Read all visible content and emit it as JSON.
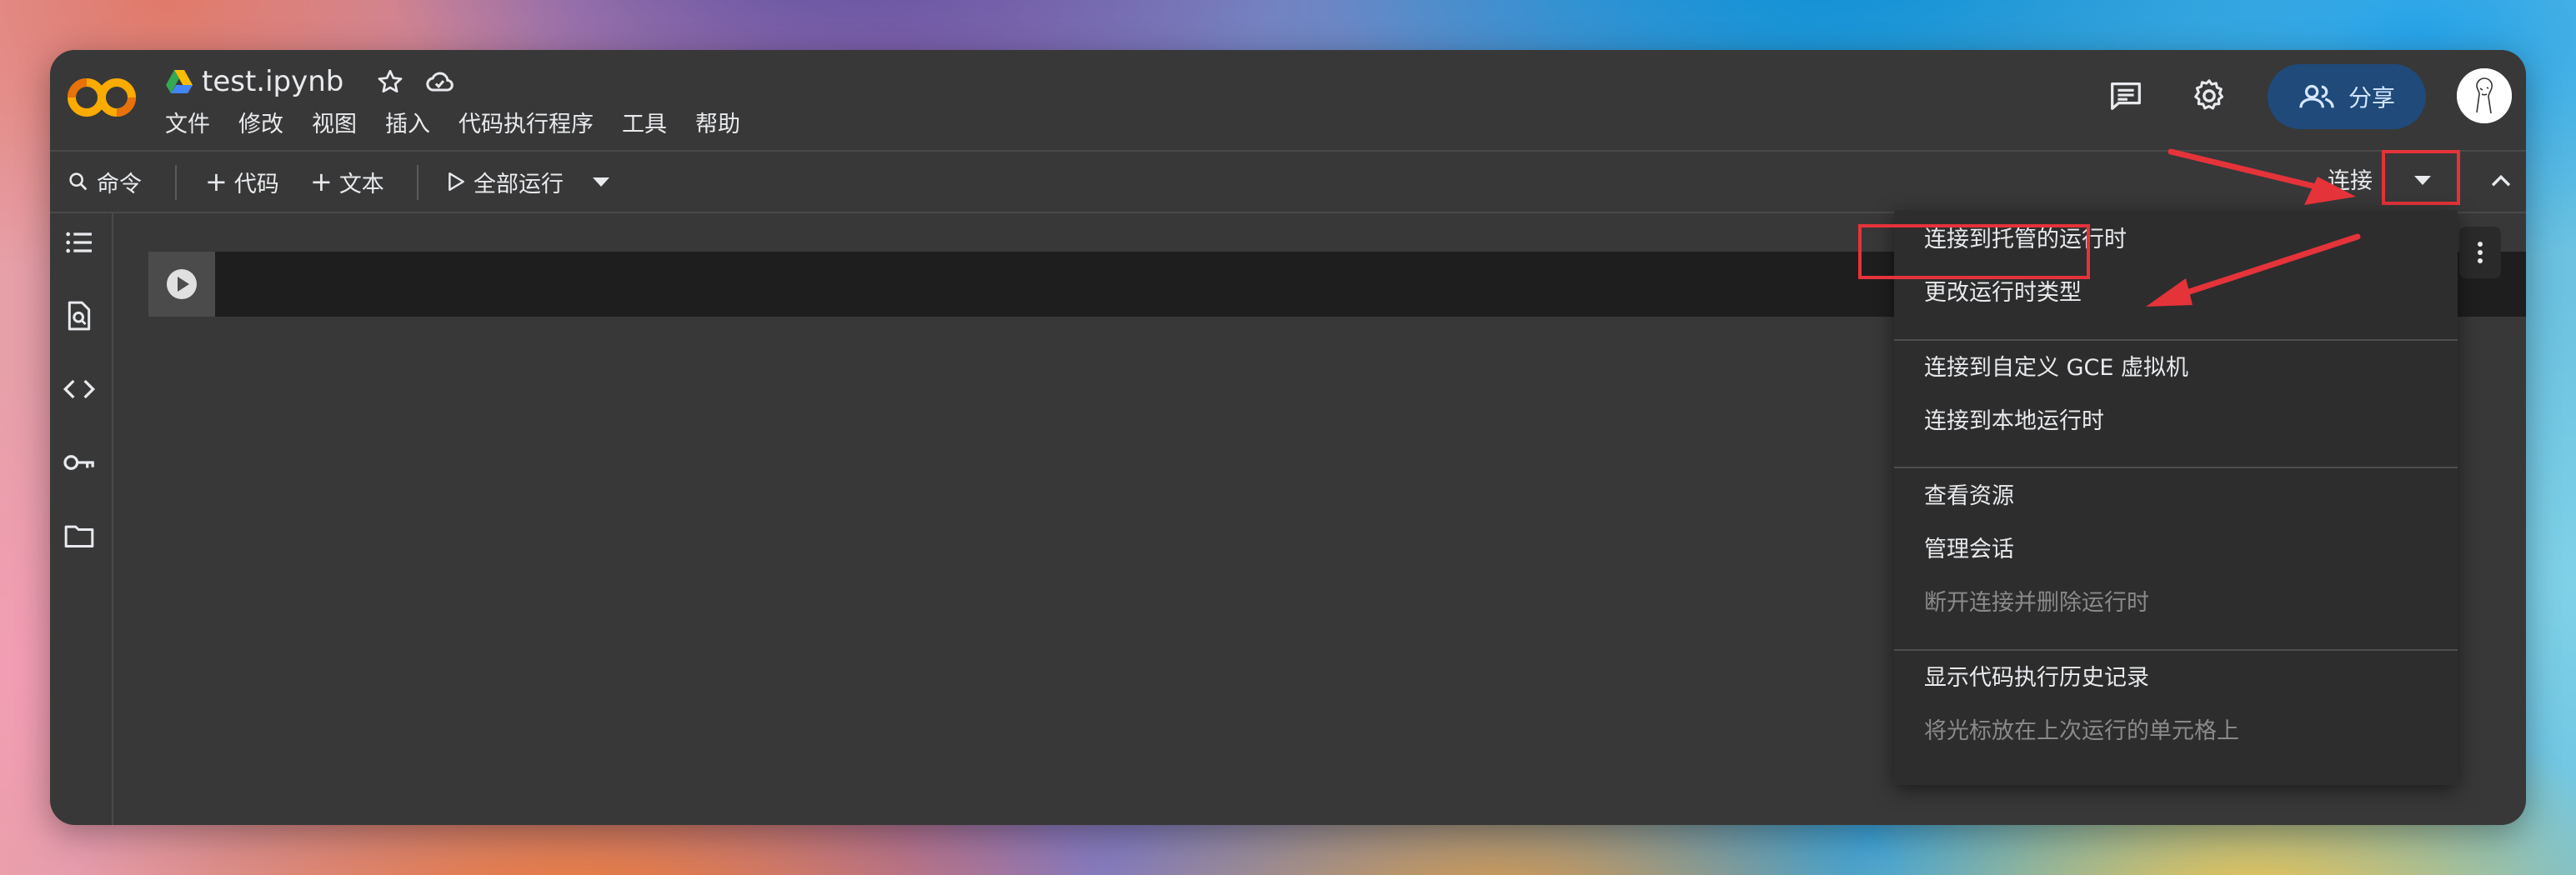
{
  "window": {
    "title": "test.ipynb"
  },
  "header": {
    "logo": "CO",
    "file_title": "test.ipynb",
    "menu": [
      "文件",
      "修改",
      "视图",
      "插入",
      "代码执行程序",
      "工具",
      "帮助"
    ],
    "share_label": "分享",
    "icons": [
      "drive-icon",
      "star-icon",
      "cloud-icon",
      "comment-icon",
      "gear-icon",
      "share-people-icon",
      "avatar"
    ]
  },
  "toolbar": {
    "command_label": "命令",
    "add_code_label": "代码",
    "add_text_label": "文本",
    "run_all_label": "全部运行",
    "connect_label": "连接"
  },
  "rail": {
    "icons": [
      "toc-icon",
      "find-icon",
      "code-snippets-icon",
      "secrets-key-icon",
      "folder-icon"
    ]
  },
  "dropdown": {
    "items": [
      {
        "label": "连接到托管的运行时",
        "enabled": true
      },
      {
        "label": "更改运行时类型",
        "enabled": true,
        "highlighted": true
      },
      {
        "label": "连接到自定义 GCE 虚拟机",
        "enabled": true
      },
      {
        "label": "连接到本地运行时",
        "enabled": true
      },
      {
        "label": "查看资源",
        "enabled": true
      },
      {
        "label": "管理会话",
        "enabled": true
      },
      {
        "label": "断开连接并删除运行时",
        "enabled": false
      },
      {
        "label": "显示代码执行历史记录",
        "enabled": true
      },
      {
        "label": "将光标放在上次运行的单元格上",
        "enabled": false
      }
    ]
  },
  "colors": {
    "window_bg": "#383838",
    "cell_bg": "#1e1e1e",
    "share_bg": "#1f4a7a",
    "annotation_red": "#e5333a",
    "logo_orange": "#f9ab00"
  }
}
